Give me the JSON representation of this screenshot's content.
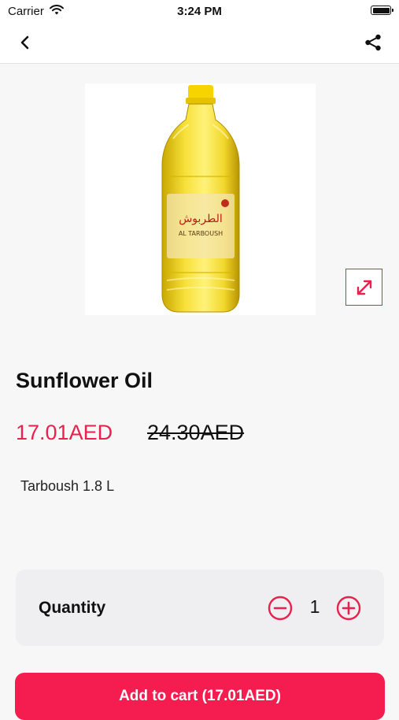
{
  "status_bar": {
    "carrier": "Carrier",
    "time": "3:24 PM"
  },
  "nav": {
    "back_icon": "chevron-left-icon",
    "share_icon": "share-icon"
  },
  "product": {
    "image_alt": "Al Tarboush sunflower oil bottle",
    "title": "Sunflower Oil",
    "price": "17.01AED",
    "old_price": "24.30AED",
    "description": "Tarboush 1.8 L",
    "bottle_label": "AL TARBOUSH"
  },
  "quantity": {
    "label": "Quantity",
    "value": "1"
  },
  "cart_button": {
    "label": "Add to cart (17.01AED)"
  },
  "colors": {
    "accent": "#e8214d",
    "button": "#f51d4f",
    "card": "#efeff1",
    "background": "#f7f7f8"
  }
}
